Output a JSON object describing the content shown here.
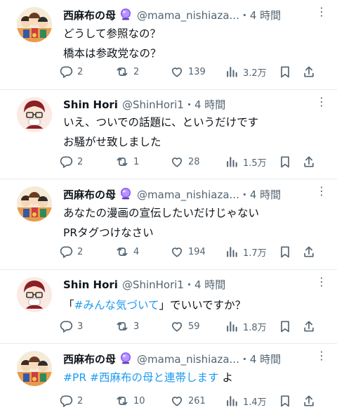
{
  "tweets": [
    {
      "name": "西麻布の母",
      "handle": "@mama_nishiaza...",
      "time": "・4 時間",
      "lines": [
        "どうして参照なの？",
        "橋本は参政党なの？"
      ],
      "replies": "2",
      "reposts": "2",
      "likes": "139",
      "views": "3.2万",
      "avatar": "illustration-avatar",
      "verified": true
    },
    {
      "name": "Shin Hori",
      "handle": "@ShinHori1",
      "time": "・4 時間",
      "lines": [
        "いえ、ついでの話題に、というだけです",
        "お騒がせ致しました"
      ],
      "replies": "2",
      "reposts": "1",
      "likes": "28",
      "views": "1.5万",
      "avatar": "cartoon-face-avatar",
      "verified": false
    },
    {
      "name": "西麻布の母",
      "handle": "@mama_nishiaza...",
      "time": "・4 時間",
      "lines": [
        "あなたの漫画の宣伝したいだけじゃない",
        "PRタグつけなさい"
      ],
      "replies": "2",
      "reposts": "4",
      "likes": "194",
      "views": "1.7万",
      "avatar": "illustration-avatar",
      "verified": true
    },
    {
      "name": "Shin Hori",
      "handle": "@ShinHori1",
      "time": "・4 時間",
      "line_parts": [
        "「",
        "#みんな気づいて",
        "」でいいですか？"
      ],
      "replies": "3",
      "reposts": "3",
      "likes": "59",
      "views": "1.8万",
      "avatar": "cartoon-face-avatar",
      "verified": false
    },
    {
      "name": "西麻布の母",
      "handle": "@mama_nishiaza...",
      "time": "・4 時間",
      "line_parts": [
        "#PR",
        "#西麻布の母と連帯します",
        "よ"
      ],
      "replies": "2",
      "reposts": "10",
      "likes": "261",
      "views": "1.4万",
      "avatar": "illustration-avatar",
      "verified": true
    }
  ],
  "more_glyph": "⋮",
  "colors": {
    "text": "#0f1419",
    "muted": "#536471",
    "link": "#1d9bf0",
    "badge": "#8a5cf6"
  }
}
